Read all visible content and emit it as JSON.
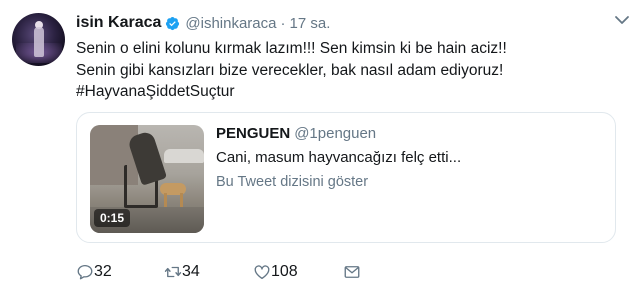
{
  "author": {
    "name": "isin Karaca",
    "handle": "@ishinkaraca",
    "separator": "·",
    "time": "17 sa."
  },
  "tweet_lines": [
    "Senin o elini kolunu kırmak lazım!!! Sen kimsin ki be hain aciz!!",
    "Senin gibi kansızları bize verecekler, bak nasıl adam ediyoruz!",
    "#HayvanaŞiddetSuçtur"
  ],
  "quoted": {
    "name": "PENGUEN",
    "handle": "@1penguen",
    "text": "Cani, masum hayvancağızı felç etti...",
    "thread_link": "Bu Tweet dizisini göster",
    "video_duration": "0:15"
  },
  "actions": {
    "reply_count": "32",
    "retweet_count": "34",
    "like_count": "108"
  },
  "colors": {
    "text": "#14171a",
    "secondary": "#657786",
    "verified": "#1da1f2",
    "border": "#e1e8ed"
  },
  "icons": [
    "verified-badge-icon",
    "caret-down-icon",
    "reply-icon",
    "retweet-icon",
    "like-icon",
    "direct-message-icon"
  ]
}
